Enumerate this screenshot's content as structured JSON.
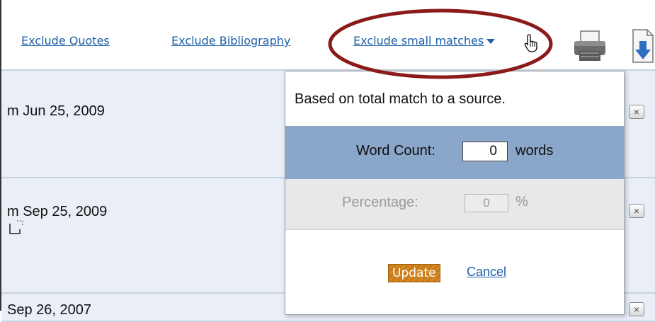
{
  "toolbar": {
    "exclude_quotes": "Exclude Quotes",
    "exclude_bibliography": "Exclude Bibliography",
    "exclude_small_matches": "Exclude small matches",
    "icons": [
      "printer-icon",
      "download-icon",
      "dropdown-caret-icon",
      "pointer-cursor-icon"
    ]
  },
  "rows": [
    {
      "date": "m Jun 25, 2009",
      "close": "×"
    },
    {
      "date": "m Sep 25, 2009",
      "close": "×"
    },
    {
      "date": "Sep 26, 2007",
      "close": "×"
    }
  ],
  "popup": {
    "description": "Based on total match to a source.",
    "word_count": {
      "label": "Word Count:",
      "value": "0",
      "unit": "words"
    },
    "percentage": {
      "label": "Percentage:",
      "value": "0",
      "unit": "%"
    },
    "update_label": "Update",
    "cancel_label": "Cancel"
  },
  "colors": {
    "link": "#1d5fa8",
    "row_bg": "#e9eef7",
    "word_count_bg": "#8aa6c8",
    "update_button": "#c77a17",
    "annotation_ellipse": "#8b1a1a"
  }
}
